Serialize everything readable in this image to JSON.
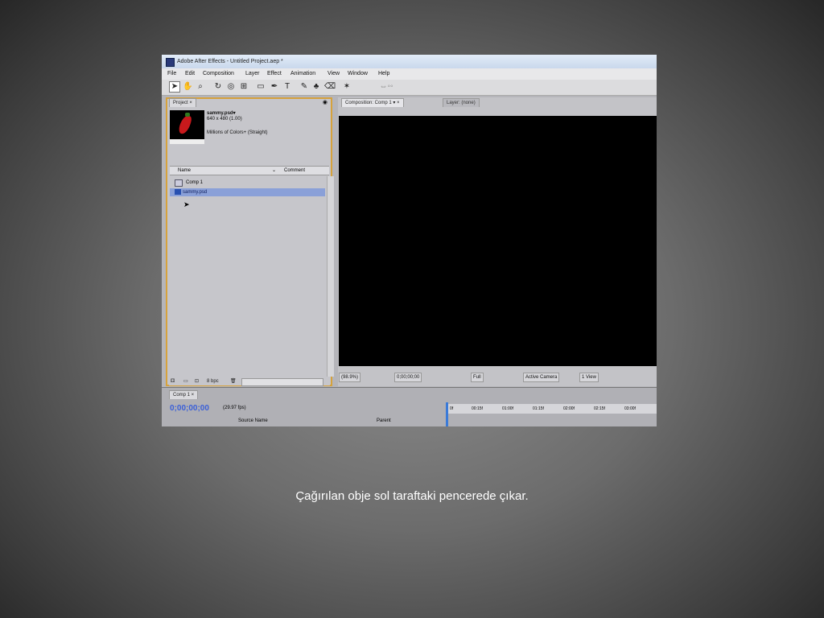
{
  "app": {
    "title": "Adobe After Effects - Untitled Project.aep *"
  },
  "menu": [
    "File",
    "Edit",
    "Composition",
    "Layer",
    "Effect",
    "Animation",
    "View",
    "Window",
    "Help"
  ],
  "project_panel": {
    "tab_label": "Project",
    "tab_close": "×",
    "item_name": "sammy.psd▾",
    "item_size": "640 x 480 (1.00)",
    "item_color": "Millions of Colors+ (Straight)",
    "columns": {
      "name": "Name",
      "comment": "Comment"
    },
    "items": [
      "Comp 1",
      "sammy.psd"
    ],
    "footer_bpc": "8 bpc"
  },
  "composition_panel": {
    "tab_comp": "Composition: Comp 1",
    "tab_layer": "Layer: (none)",
    "zoom": "(98.9%)",
    "timecode": "0;00;00;00",
    "resolution": "Full",
    "camera": "Active Camera",
    "views": "1 View"
  },
  "timeline": {
    "tab_label": "Comp 1",
    "timecode": "0;00;00;00",
    "fps": "(29.97 fps)",
    "col_source": "Source Name",
    "col_parent": "Parent",
    "ruler_marks": [
      "0f",
      "00:15f",
      "01:00f",
      "01:15f",
      "02:00f",
      "02:15f",
      "03:00f"
    ]
  },
  "caption": "Çağırılan obje sol taraftaki pencerede çıkar.",
  "colors": {
    "panel_highlight": "#d6a23c",
    "timecode": "#3a5fd8",
    "background": "#6c6c6c"
  }
}
